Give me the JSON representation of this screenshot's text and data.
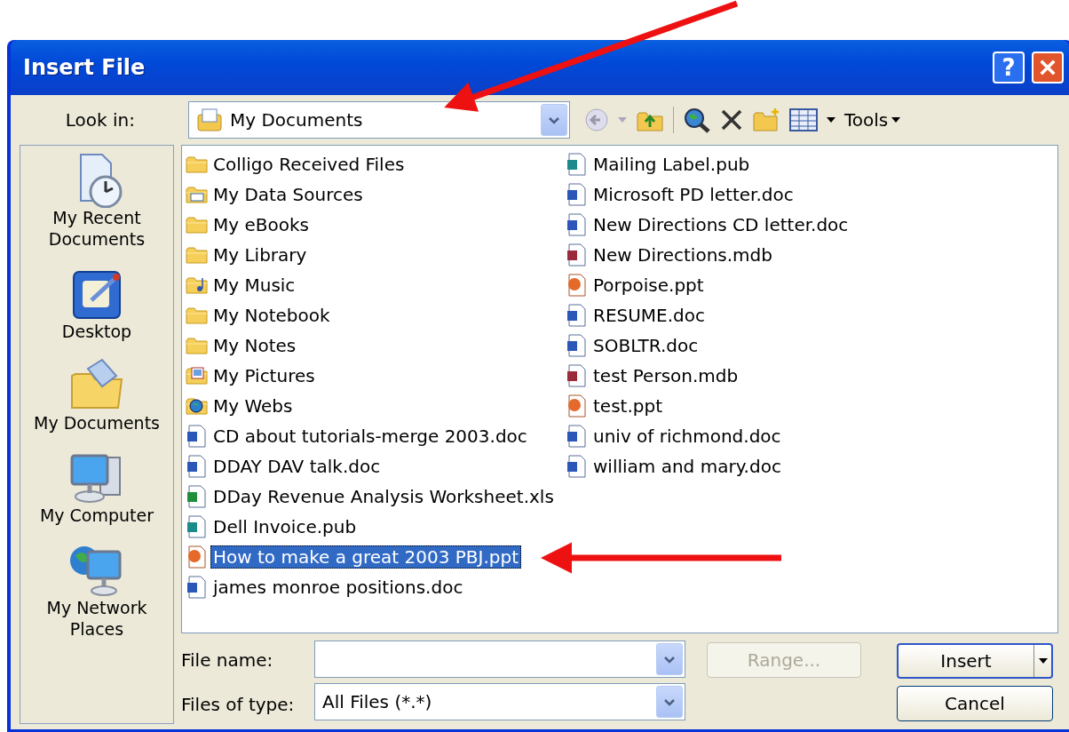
{
  "window": {
    "title": "Insert File",
    "help_button": "?"
  },
  "look_in": {
    "label": "Look in:",
    "value": "My Documents"
  },
  "toolbar": {
    "tools_menu": "Tools"
  },
  "places": [
    {
      "label": "My Recent Documents",
      "kind": "recent"
    },
    {
      "label": "Desktop",
      "kind": "desktop"
    },
    {
      "label": "My Documents",
      "kind": "documents"
    },
    {
      "label": "My Computer",
      "kind": "computer"
    },
    {
      "label": "My Network Places",
      "kind": "network"
    }
  ],
  "files": [
    {
      "name": "Colligo Received Files",
      "kind": "folder",
      "selected": false
    },
    {
      "name": "My Data Sources",
      "kind": "datafolder",
      "selected": false
    },
    {
      "name": "My eBooks",
      "kind": "folder",
      "selected": false
    },
    {
      "name": "My Library",
      "kind": "folder",
      "selected": false
    },
    {
      "name": "My Music",
      "kind": "musicfolder",
      "selected": false
    },
    {
      "name": "My Notebook",
      "kind": "folder",
      "selected": false
    },
    {
      "name": "My Notes",
      "kind": "folder",
      "selected": false
    },
    {
      "name": "My Pictures",
      "kind": "picturefolder",
      "selected": false
    },
    {
      "name": "My Webs",
      "kind": "webfolder",
      "selected": false
    },
    {
      "name": "CD about tutorials-merge 2003.doc",
      "kind": "doc",
      "selected": false
    },
    {
      "name": "DDAY DAV talk.doc",
      "kind": "doc",
      "selected": false
    },
    {
      "name": "DDay Revenue Analysis Worksheet.xls",
      "kind": "xls",
      "selected": false
    },
    {
      "name": "Dell Invoice.pub",
      "kind": "pub",
      "selected": false
    },
    {
      "name": "How to make a great 2003 PBJ.ppt",
      "kind": "ppt",
      "selected": true
    },
    {
      "name": "james monroe positions.doc",
      "kind": "doc",
      "selected": false
    },
    {
      "name": "Mailing Label.pub",
      "kind": "pub",
      "selected": false
    },
    {
      "name": "Microsoft PD letter.doc",
      "kind": "doc",
      "selected": false
    },
    {
      "name": "New Directions CD letter.doc",
      "kind": "doc",
      "selected": false
    },
    {
      "name": "New Directions.mdb",
      "kind": "mdb",
      "selected": false
    },
    {
      "name": "Porpoise.ppt",
      "kind": "ppt",
      "selected": false
    },
    {
      "name": "RESUME.doc",
      "kind": "doc",
      "selected": false
    },
    {
      "name": "SOBLTR.doc",
      "kind": "doc",
      "selected": false
    },
    {
      "name": "test Person.mdb",
      "kind": "mdb",
      "selected": false
    },
    {
      "name": "test.ppt",
      "kind": "ppt",
      "selected": false
    },
    {
      "name": "univ of richmond.doc",
      "kind": "doc",
      "selected": false
    },
    {
      "name": "william and mary.doc",
      "kind": "doc",
      "selected": false
    }
  ],
  "file_name": {
    "label": "File name:"
  },
  "files_of_type": {
    "label": "Files of type:",
    "value": "All Files (*.*)"
  },
  "buttons": [
    {
      "label": "Range...",
      "disabled": true,
      "split": false
    },
    {
      "label": "Insert",
      "disabled": false,
      "split": true
    },
    {
      "label": "Cancel",
      "disabled": false,
      "split": false
    }
  ]
}
